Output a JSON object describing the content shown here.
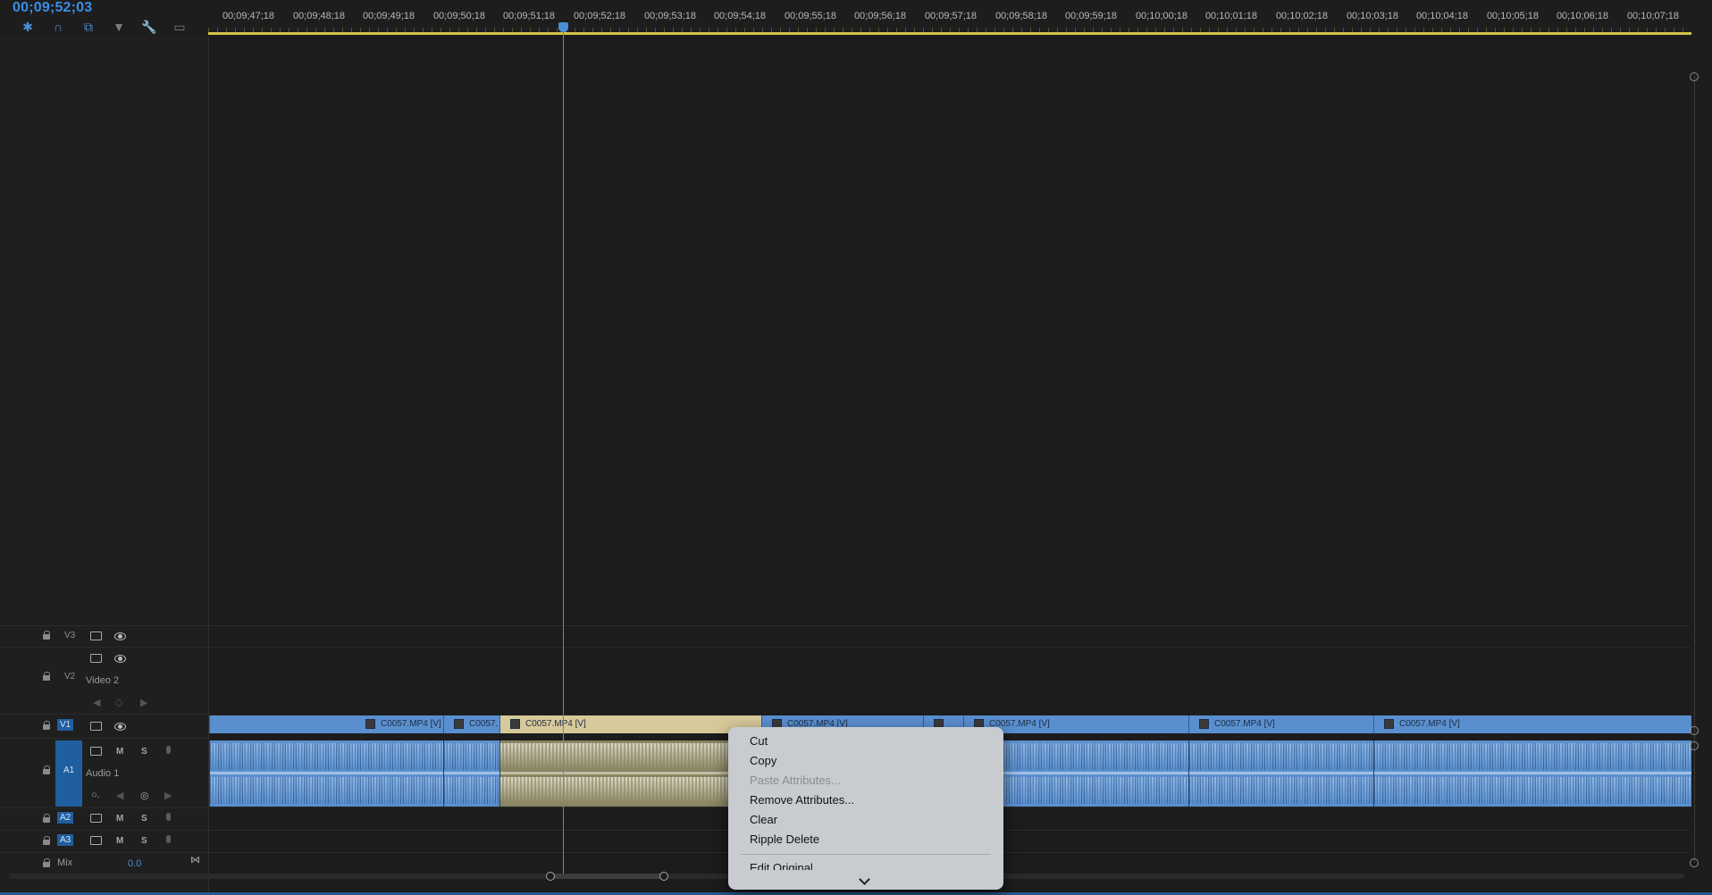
{
  "timecode": "00;09;52;03",
  "toolbar": [
    "nest-icon",
    "magnet-icon",
    "linked-selection-icon",
    "marker-icon",
    "wrench-icon",
    "captions-icon"
  ],
  "ruler": [
    "00;09;47;18",
    "00;09;48;18",
    "00;09;49;18",
    "00;09;50;18",
    "00;09;51;18",
    "00;09;52;18",
    "00;09;53;18",
    "00;09;54;18",
    "00;09;55;18",
    "00;09;56;18",
    "00;09;57;18",
    "00;09;58;18",
    "00;09;59;18",
    "00;10;00;18",
    "00;10;01;18",
    "00;10;02;18",
    "00;10;03;18",
    "00;10;04;18",
    "00;10;05;18",
    "00;10;06;18",
    "00;10;07;18"
  ],
  "tracks": {
    "v3": "V3",
    "v2": "V2",
    "v2_name": "Video 2",
    "v1": "V1",
    "a1": "A1",
    "a1_name": "Audio 1",
    "a2": "A2",
    "a3": "A3",
    "mute": "M",
    "solo": "S",
    "mix": "Mix",
    "mix_value": "0.0"
  },
  "clips": {
    "c1": "C0057.MP4 [V]",
    "c2": "C0057.",
    "c3": "C0057.MP4 [V]",
    "c4": "C0057.MP4 [V]",
    "c5": "C0057.MP4 [V]",
    "c6": "C0057.MP4 [V]",
    "c7": "C0057.MP4 [V]"
  },
  "menu": {
    "cut": "Cut",
    "copy": "Copy",
    "paste_attributes": "Paste Attributes...",
    "remove_attributes": "Remove Attributes...",
    "clear": "Clear",
    "ripple_delete": "Ripple Delete",
    "edit_original": "Edit Original"
  },
  "colors": {
    "accent": "#4b8fd6",
    "clip": "#5a8fcf",
    "selected_clip": "#d8c99a",
    "ruler": "#d2c54a"
  }
}
